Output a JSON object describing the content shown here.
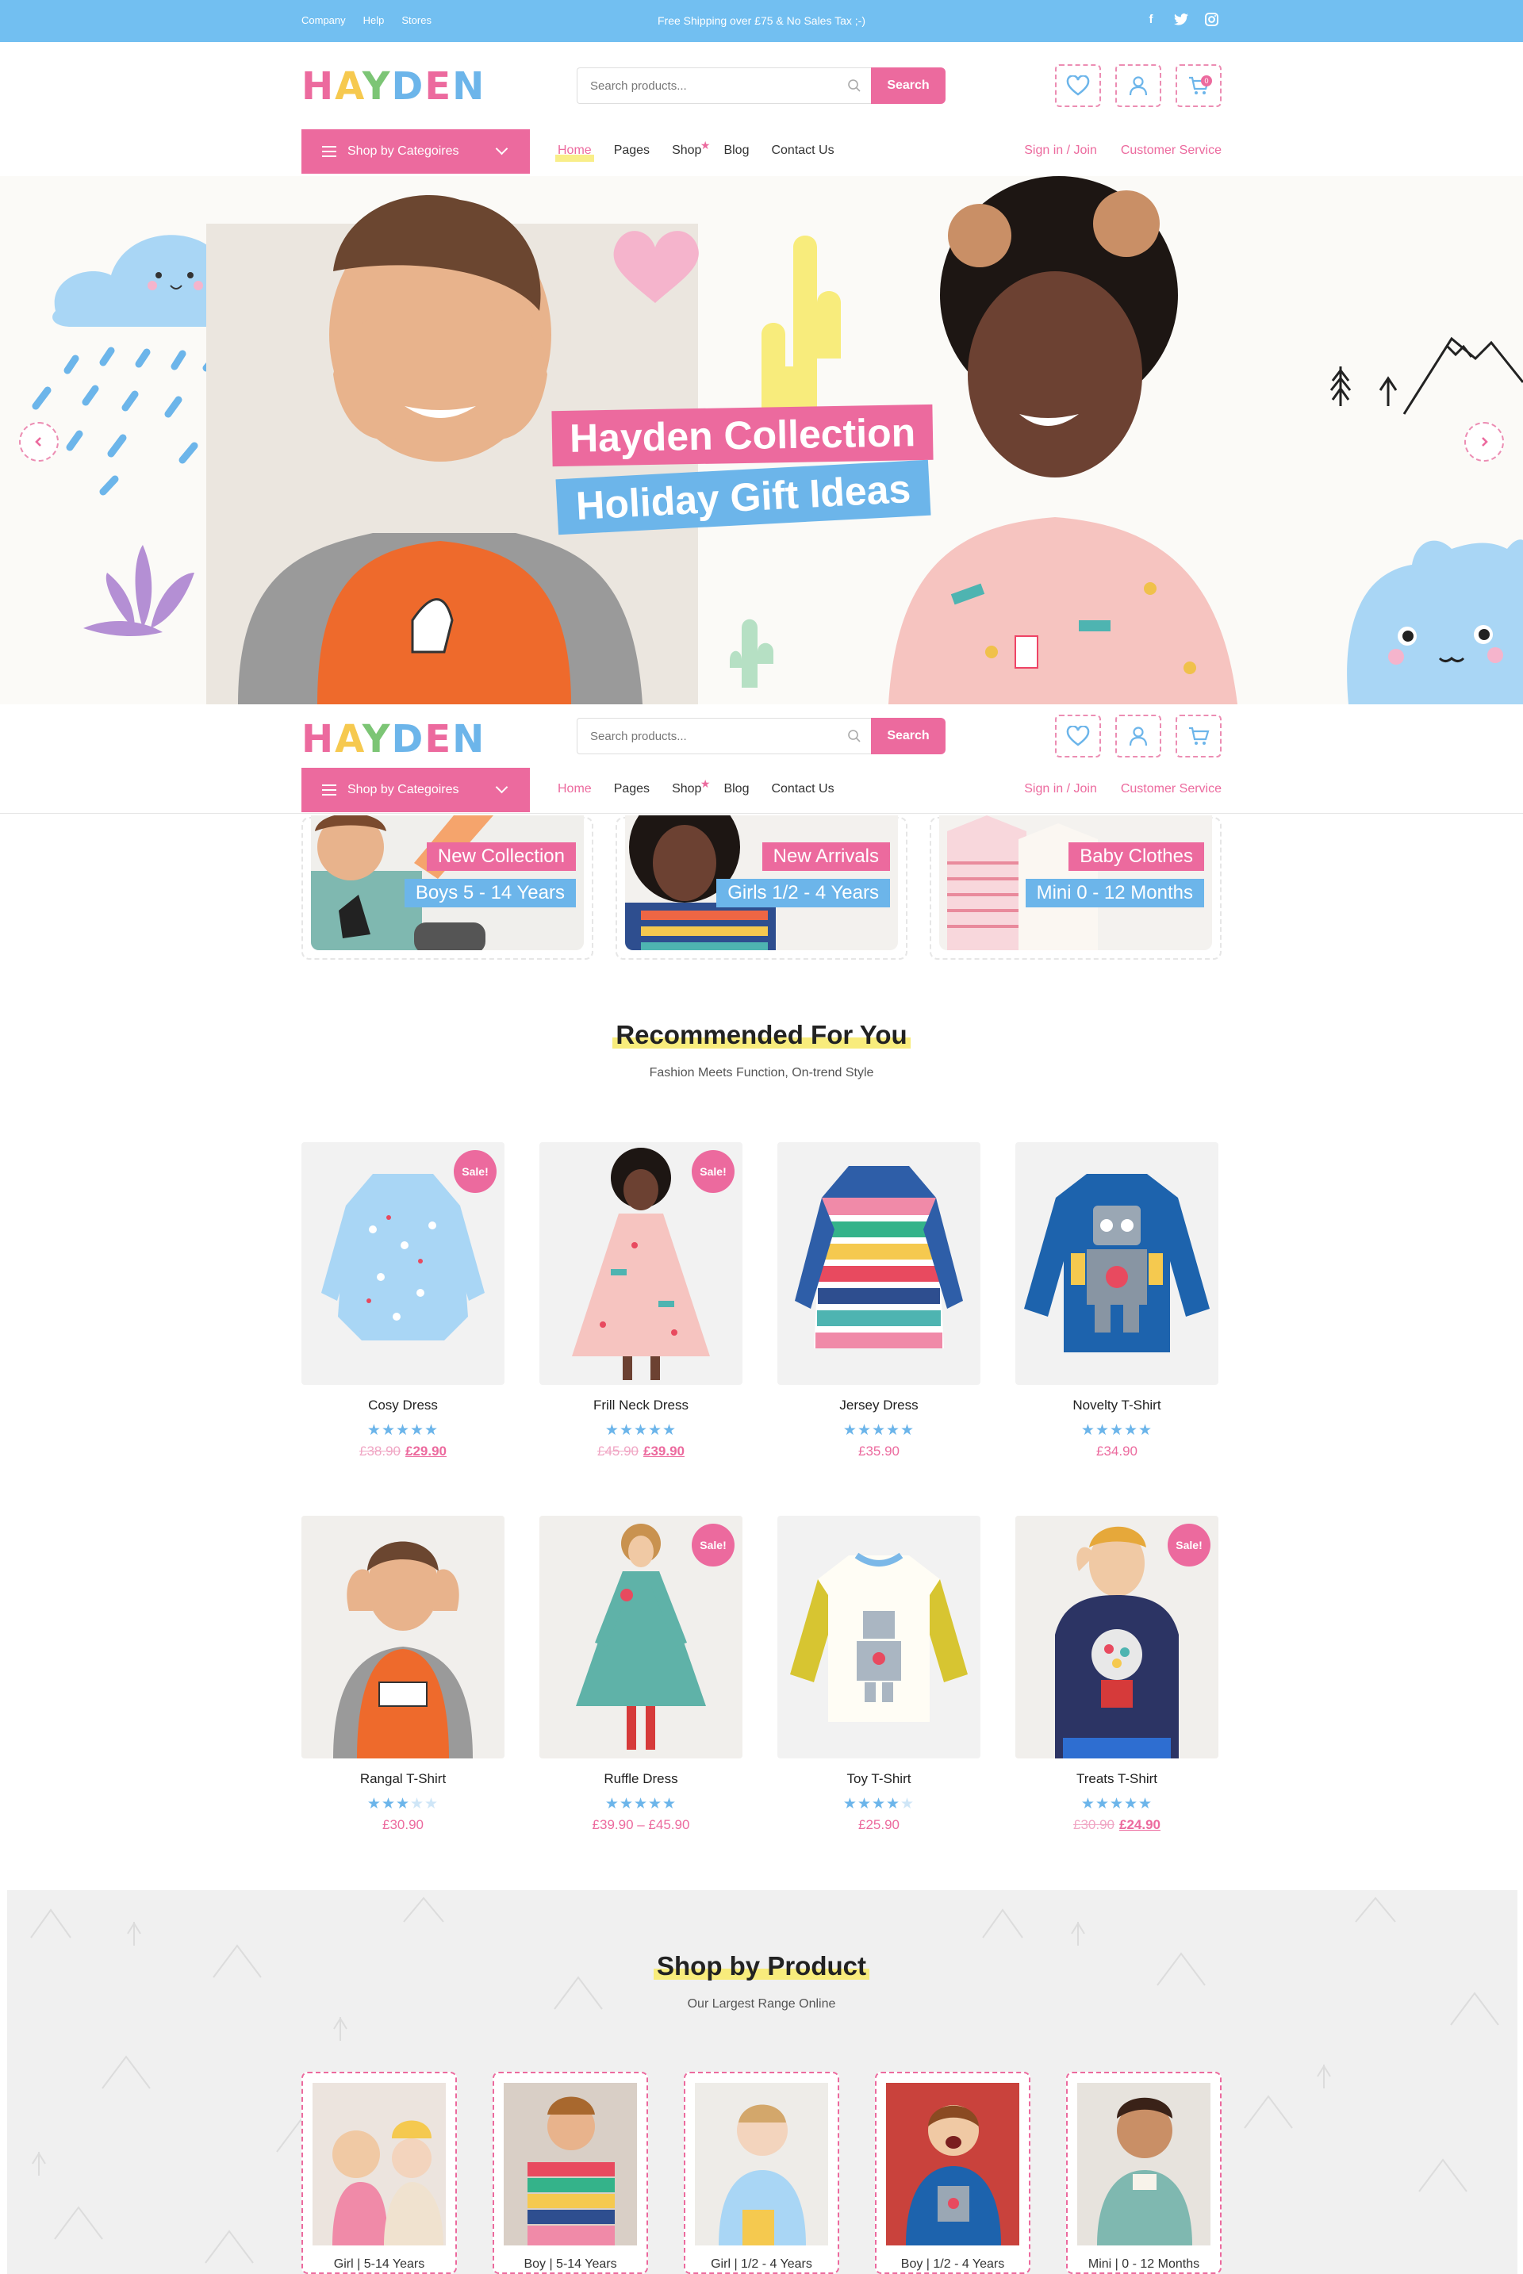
{
  "topbar": {
    "links": [
      "Company",
      "Help",
      "Stores"
    ],
    "shipping": "Free Shipping over £75 & No Sales Tax ;-)",
    "social": [
      "facebook-icon",
      "twitter-icon",
      "instagram-icon"
    ]
  },
  "header": {
    "logo": [
      "H",
      "A",
      "Y",
      "D",
      "E",
      "N"
    ],
    "search_placeholder": "Search products...",
    "search_button": "Search",
    "cart_count": "0"
  },
  "nav": {
    "category_button": "Shop by Categoires",
    "menu": [
      "Home",
      "Pages",
      "Shop",
      "Blog",
      "Contact Us"
    ],
    "account": [
      "Sign in / Join",
      "Customer Service"
    ]
  },
  "hero": {
    "title1": "Hayden Collection",
    "title2": "Holiday Gift Ideas"
  },
  "collections": [
    {
      "tag1": "New Collection",
      "tag2": "Boys 5 - 14 Years"
    },
    {
      "tag1": "New Arrivals",
      "tag2": "Girls 1/2 - 4 Years"
    },
    {
      "tag1": "Baby Clothes",
      "tag2": "Mini 0 - 12 Months"
    }
  ],
  "recommended": {
    "title": "Recommended For You",
    "subtitle": "Fashion Meets Function, On-trend Style",
    "sale_label": "Sale!",
    "products": [
      {
        "name": "Cosy Dress",
        "rating": 5,
        "old": "£38.90",
        "price": "£29.90",
        "sale": true
      },
      {
        "name": "Frill Neck Dress",
        "rating": 5,
        "old": "£45.90",
        "price": "£39.90",
        "sale": true
      },
      {
        "name": "Jersey Dress",
        "rating": 5,
        "old": "",
        "price": "£35.90",
        "sale": false
      },
      {
        "name": "Novelty T-Shirt",
        "rating": 5,
        "old": "",
        "price": "£34.90",
        "sale": false
      },
      {
        "name": "Rangal T-Shirt",
        "rating": 3,
        "old": "",
        "price": "£30.90",
        "sale": false
      },
      {
        "name": "Ruffle Dress",
        "rating": 5,
        "old": "",
        "price": "£39.90 – £45.90",
        "sale": true
      },
      {
        "name": "Toy T-Shirt",
        "rating": 4,
        "old": "",
        "price": "£25.90",
        "sale": false
      },
      {
        "name": "Treats T-Shirt",
        "rating": 5,
        "old": "£30.90",
        "price": "£24.90",
        "sale": true
      }
    ]
  },
  "shop_by_product": {
    "title": "Shop by Product",
    "subtitle": "Our Largest Range Online",
    "items": [
      "Girl | 5-14 Years",
      "Boy | 5-14 Years",
      "Girl | 1/2 - 4 Years",
      "Boy | 1/2 - 4 Years",
      "Mini | 0 - 12 Months"
    ]
  }
}
